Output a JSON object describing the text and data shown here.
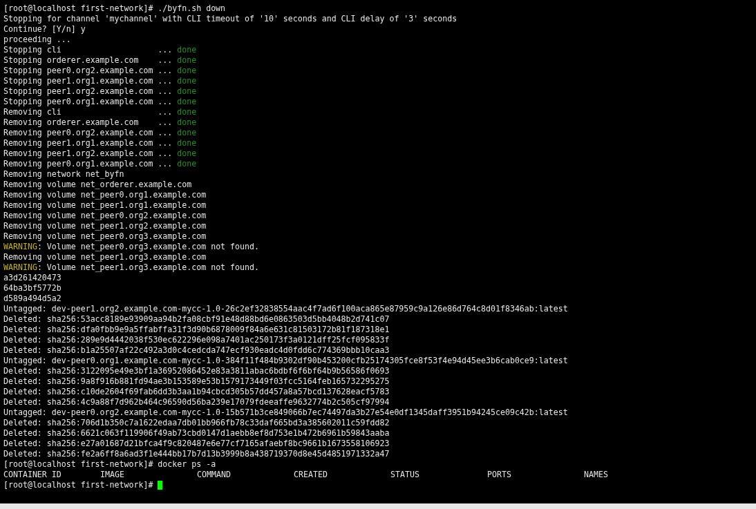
{
  "terminal": {
    "lines": [
      {
        "kind": "plain",
        "text": "[root@localhost first-network]# ./byfn.sh down"
      },
      {
        "kind": "plain",
        "text": "Stopping for channel 'mychannel' with CLI timeout of '10' seconds and CLI delay of '3' seconds"
      },
      {
        "kind": "plain",
        "text": "Continue? [Y/n] y"
      },
      {
        "kind": "plain",
        "text": "proceeding ..."
      },
      {
        "kind": "status",
        "label": "Stopping cli",
        "dots": "...",
        "status": "done"
      },
      {
        "kind": "status",
        "label": "Stopping orderer.example.com",
        "dots": "...",
        "status": "done"
      },
      {
        "kind": "status",
        "label": "Stopping peer0.org2.example.com",
        "dots": "...",
        "status": "done"
      },
      {
        "kind": "status",
        "label": "Stopping peer1.org1.example.com",
        "dots": "...",
        "status": "done"
      },
      {
        "kind": "status",
        "label": "Stopping peer1.org2.example.com",
        "dots": "...",
        "status": "done"
      },
      {
        "kind": "status",
        "label": "Stopping peer0.org1.example.com",
        "dots": "...",
        "status": "done"
      },
      {
        "kind": "status",
        "label": "Removing cli",
        "dots": "...",
        "status": "done"
      },
      {
        "kind": "status",
        "label": "Removing orderer.example.com",
        "dots": "...",
        "status": "done"
      },
      {
        "kind": "status",
        "label": "Removing peer0.org2.example.com",
        "dots": "...",
        "status": "done"
      },
      {
        "kind": "status",
        "label": "Removing peer1.org1.example.com",
        "dots": "...",
        "status": "done"
      },
      {
        "kind": "status",
        "label": "Removing peer1.org2.example.com",
        "dots": "...",
        "status": "done"
      },
      {
        "kind": "status",
        "label": "Removing peer0.org1.example.com",
        "dots": "...",
        "status": "done"
      },
      {
        "kind": "plain",
        "text": "Removing network net_byfn"
      },
      {
        "kind": "plain",
        "text": "Removing volume net_orderer.example.com"
      },
      {
        "kind": "plain",
        "text": "Removing volume net_peer0.org1.example.com"
      },
      {
        "kind": "plain",
        "text": "Removing volume net_peer1.org1.example.com"
      },
      {
        "kind": "plain",
        "text": "Removing volume net_peer0.org2.example.com"
      },
      {
        "kind": "plain",
        "text": "Removing volume net_peer1.org2.example.com"
      },
      {
        "kind": "plain",
        "text": "Removing volume net_peer0.org3.example.com"
      },
      {
        "kind": "warning",
        "tag": "WARNING",
        "text": ": Volume net_peer0.org3.example.com not found."
      },
      {
        "kind": "plain",
        "text": "Removing volume net_peer1.org3.example.com"
      },
      {
        "kind": "warning",
        "tag": "WARNING",
        "text": ": Volume net_peer1.org3.example.com not found."
      },
      {
        "kind": "plain",
        "text": "a3d261420473"
      },
      {
        "kind": "plain",
        "text": "64ba3bf5772b"
      },
      {
        "kind": "plain",
        "text": "d589a494d5a2"
      },
      {
        "kind": "plain",
        "text": "Untagged: dev-peer1.org2.example.com-mycc-1.0-26c2ef32838554aac4f7ad6f100aca865e87959c9a126e86d764c8d01f8346ab:latest"
      },
      {
        "kind": "plain",
        "text": "Deleted: sha256:53acc8189e93909aa94b2fa08cbf91e48d88bd6e0863503d5bb4048b2d741c07"
      },
      {
        "kind": "plain",
        "text": "Deleted: sha256:dfa0fbb9e9a5ffabffa31f3d90b6878009f84a6e631c81503172b81f187318e1"
      },
      {
        "kind": "plain",
        "text": "Deleted: sha256:289e9d4442038f530ec622296e098a7401ac250173f3a0121dff25fcf095833f"
      },
      {
        "kind": "plain",
        "text": "Deleted: sha256:b1a25507af22c492a3d0c4cedcda747ecf930eadc4d0fdd6c774369bbb10caa3"
      },
      {
        "kind": "plain",
        "text": "Untagged: dev-peer0.org1.example.com-mycc-1.0-384f11f484b9302df90b453200cfb25174305fce8f53f4e94d45ee3b6cab0ce9:latest"
      },
      {
        "kind": "plain",
        "text": "Deleted: sha256:3122095e49e3bf1a36952086452e83a3811abac6bdbf6f6bf64b9b56586f0693"
      },
      {
        "kind": "plain",
        "text": "Deleted: sha256:9a8f916b881fd94ae3b153589e53b1579173449f03fcc5164feb165732295275"
      },
      {
        "kind": "plain",
        "text": "Deleted: sha256:c10de2604f69fab6dd3b3aa1b94cbcd305b57dd457a8a57bcd137628eacf5783"
      },
      {
        "kind": "plain",
        "text": "Deleted: sha256:4c9a88f7d962b464c96590d56ba239e17079fdeeaffe9632774b2c505cf97994"
      },
      {
        "kind": "plain",
        "text": "Untagged: dev-peer0.org2.example.com-mycc-1.0-15b571b3ce849066b7ec74497da3b27e54e0df1345daff3951b94245ce09c42b:latest"
      },
      {
        "kind": "plain",
        "text": "Deleted: sha256:706d1b350c7a1622edaa7db01bb966fb78c33daf665bd3a385602011c59fdd82"
      },
      {
        "kind": "plain",
        "text": "Deleted: sha256:6621c063f119906f49ab73cbd0147d1aebb8ef8d753e1b472b6961b59843aaba"
      },
      {
        "kind": "plain",
        "text": "Deleted: sha256:e27a01687d21bfca4f9c820487e6e77cf7165afaebf8bc9661b1673558106923"
      },
      {
        "kind": "plain",
        "text": "Deleted: sha256:fe2a6ff8a6ad3f1e444bb17b7d13b3999b8a438719370d8e45d4851971332a47"
      },
      {
        "kind": "plain",
        "text": "[root@localhost first-network]# docker ps -a"
      },
      {
        "kind": "columns",
        "cells": [
          "CONTAINER ID",
          "IMAGE",
          "COMMAND",
          "CREATED",
          "STATUS",
          "PORTS",
          "NAMES"
        ]
      },
      {
        "kind": "prompt",
        "text": "[root@localhost first-network]#",
        "cursor": true
      }
    ]
  }
}
